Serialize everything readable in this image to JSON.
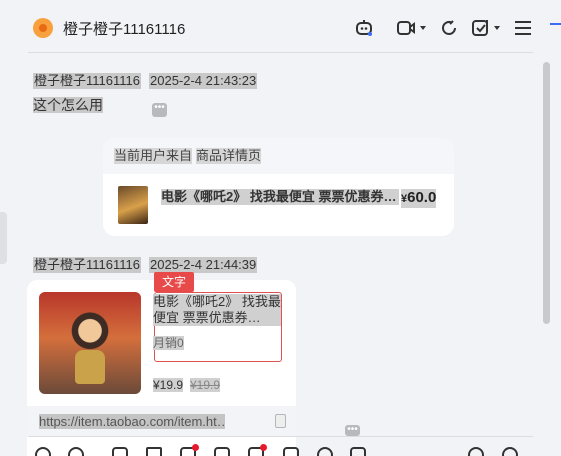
{
  "header": {
    "title": "橙子橙子11161116",
    "icons": [
      "robot-icon",
      "video-call-icon",
      "refresh-icon",
      "add-task-icon",
      "menu-icon"
    ],
    "accent": "#3b6ef5"
  },
  "messages": [
    {
      "sender": "橙子橙子11161116",
      "time": "2025-2-4 21:43:23",
      "text": "这个怎么用",
      "more": "•••"
    },
    {
      "sender": "橙子橙子11161116",
      "time": "2025-2-4 21:44:39"
    }
  ],
  "source_card": {
    "head_prefix": "当前用户来自",
    "head_source": "商品详情页",
    "product_name": "电影《哪吒2》 找我最便宜 票票优惠券…",
    "price_symbol": "¥",
    "price": "60.0"
  },
  "product_card": {
    "tag": "文字",
    "name": "电影《哪吒2》 找我最便宜 票票优惠券…",
    "sales": "月销0",
    "price": "¥19.9",
    "original_price": "¥19.9",
    "url": "https://item.taobao.com/item.ht…"
  },
  "bottom_more": "•••",
  "toolbar": {
    "icons": [
      "emoji-icon",
      "scissors-icon",
      "file-icon",
      "magic-icon",
      "coupon-icon",
      "share-icon",
      "order-icon",
      "gift-icon",
      "chat-icon",
      "history-icon",
      "more-icon",
      "settings-icon"
    ],
    "badge_color": "#e8192c"
  }
}
